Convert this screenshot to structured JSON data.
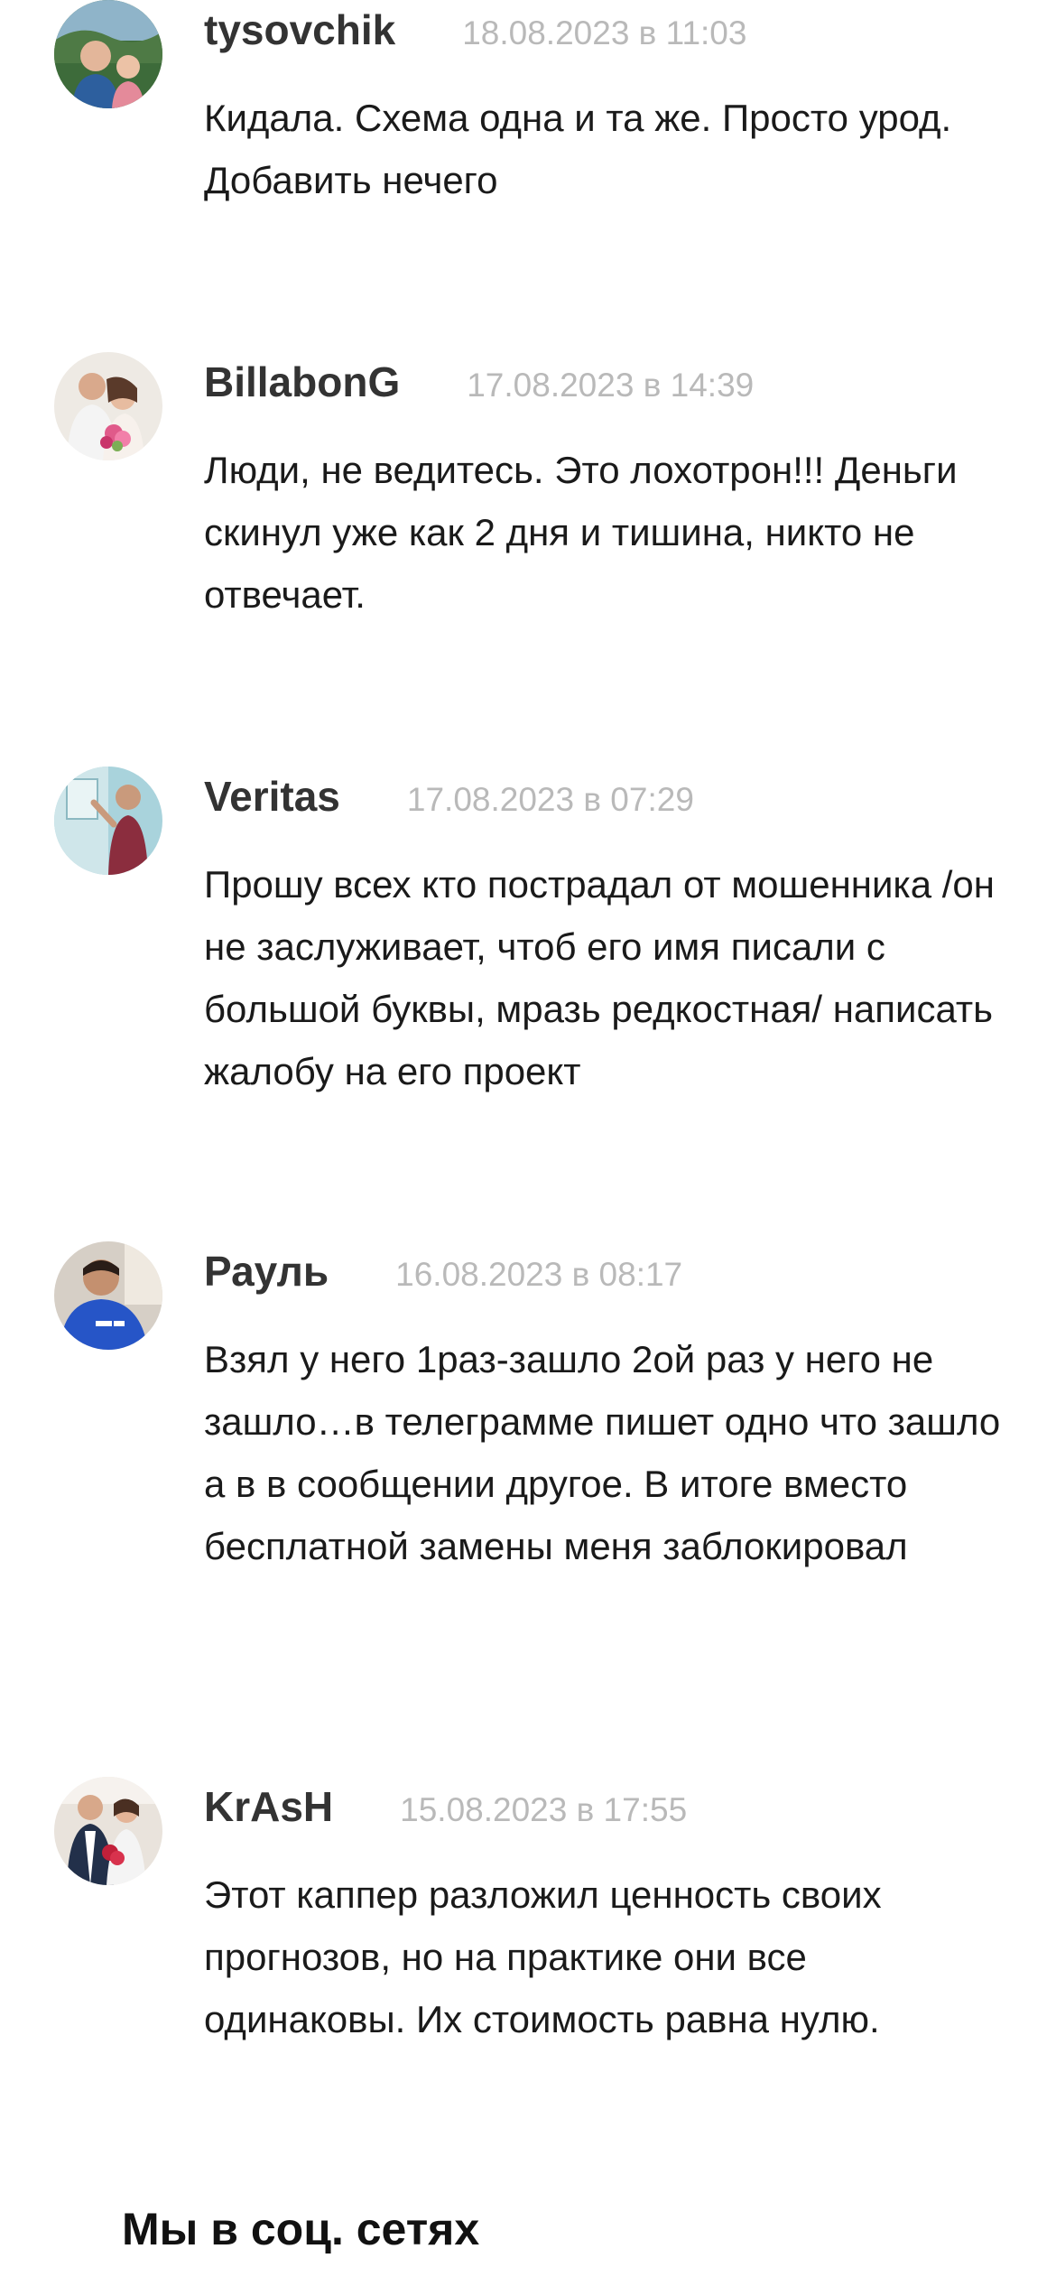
{
  "comments": [
    {
      "author": "tysovchik",
      "date": "18.08.2023 в 11:03",
      "text": "Кидала. Схема одна и та же. Просто урод. Добавить нечего"
    },
    {
      "author": "BillabonG",
      "date": "17.08.2023 в 14:39",
      "text": "Люди, не ведитесь. Это лохотрон!!! Деньги скинул уже как 2 дня и тишина, никто не отвечает."
    },
    {
      "author": "Veritas",
      "date": "17.08.2023 в 07:29",
      "text": "Прошу всех кто пострадал от мошенника /он не заслуживает, чтоб его имя писали с большой буквы, мразь редкостная/ написать жалобу на его проект"
    },
    {
      "author": "Рауль",
      "date": "16.08.2023 в 08:17",
      "text": "Взял у него 1раз-зашло 2ой раз у него не зашло…в телеграмме пишет одно что зашло а в в сообщении другое. В итоге вместо бесплатной замены меня заблокировал"
    },
    {
      "author": "KrAsH",
      "date": "15.08.2023 в 17:55",
      "text": "Этот каппер разложил ценность своих прогнозов, но на практике они все одинаковы. Их стоимость равна нулю."
    }
  ],
  "social": {
    "title": "Мы в соц. сетях"
  }
}
